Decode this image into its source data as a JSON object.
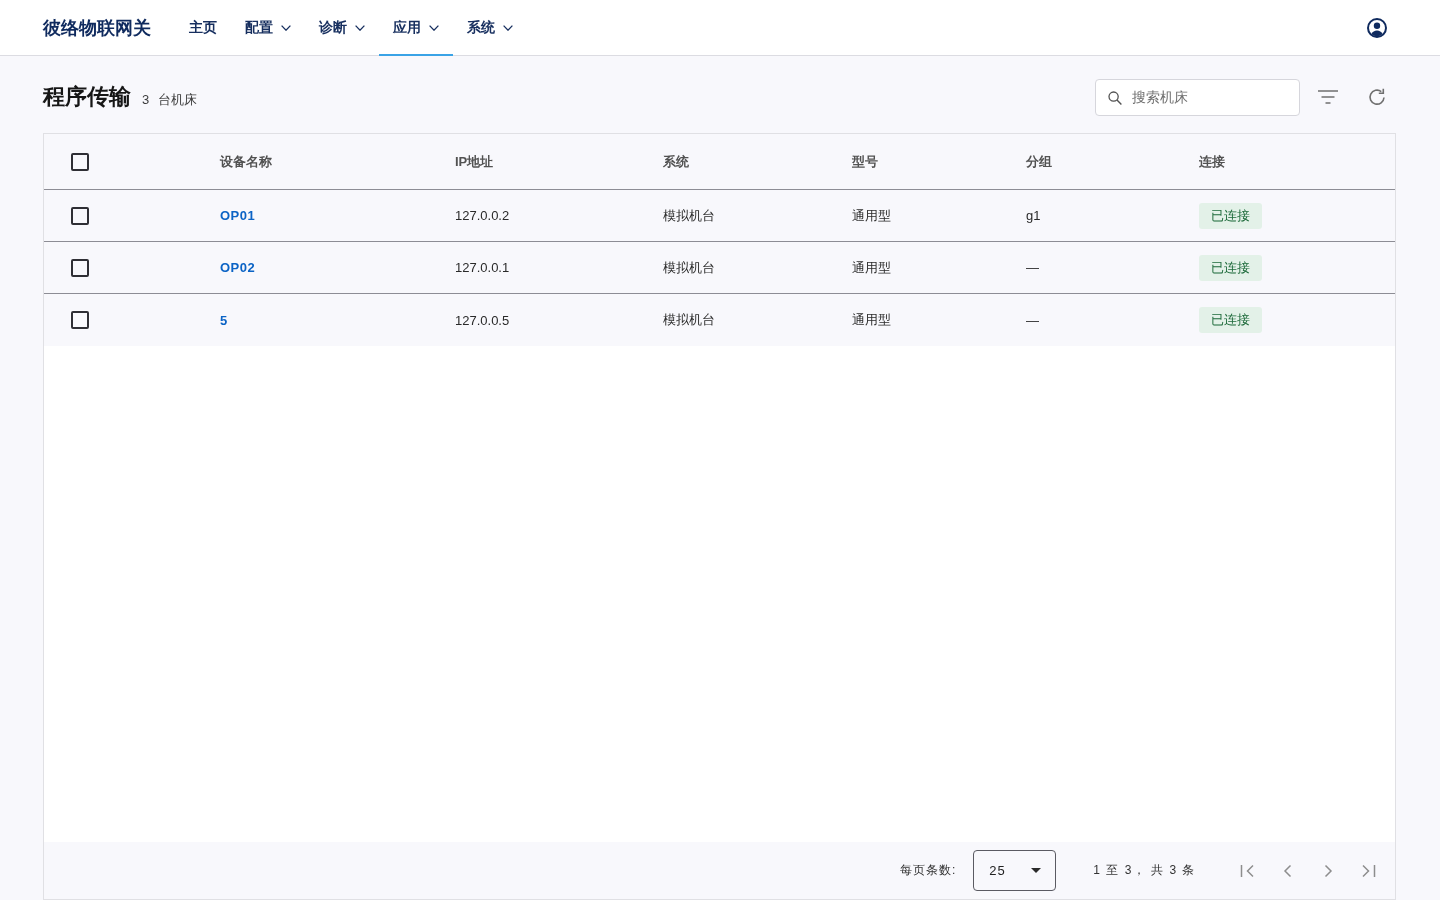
{
  "header": {
    "logo": "彼络物联网关",
    "nav": [
      {
        "label": "主页",
        "has_menu": false,
        "selected": false
      },
      {
        "label": "配置",
        "has_menu": true,
        "selected": false
      },
      {
        "label": "诊断",
        "has_menu": true,
        "selected": false
      },
      {
        "label": "应用",
        "has_menu": true,
        "selected": true
      },
      {
        "label": "系统",
        "has_menu": true,
        "selected": false
      }
    ]
  },
  "page": {
    "title": "程序传输",
    "count": "3 台机床"
  },
  "toolbar": {
    "search": {
      "placeholder": "搜索机床"
    }
  },
  "table": {
    "select_all": {
      "checked": false
    },
    "columns": [
      "设备名称",
      "IP地址",
      "系统",
      "型号",
      "分组",
      "连接"
    ],
    "rows": [
      {
        "checked": false,
        "name": "OP01",
        "ip": "127.0.0.2",
        "system": "模拟机台",
        "model": "通用型",
        "group": "g1",
        "connection": {
          "label": "已连接",
          "kind": "connected"
        }
      },
      {
        "checked": false,
        "name": "OP02",
        "ip": "127.0.0.1",
        "system": "模拟机台",
        "model": "通用型",
        "group": "—",
        "connection": {
          "label": "已连接",
          "kind": "connected"
        }
      },
      {
        "checked": false,
        "name": "5",
        "ip": "127.0.0.5",
        "system": "模拟机台",
        "model": "通用型",
        "group": "—",
        "connection": {
          "label": "已连接",
          "kind": "connected"
        }
      }
    ]
  },
  "pagination": {
    "page_size_label": "每页条数:",
    "page_size": "25",
    "range": "1 至 3， 共 3 条"
  }
}
